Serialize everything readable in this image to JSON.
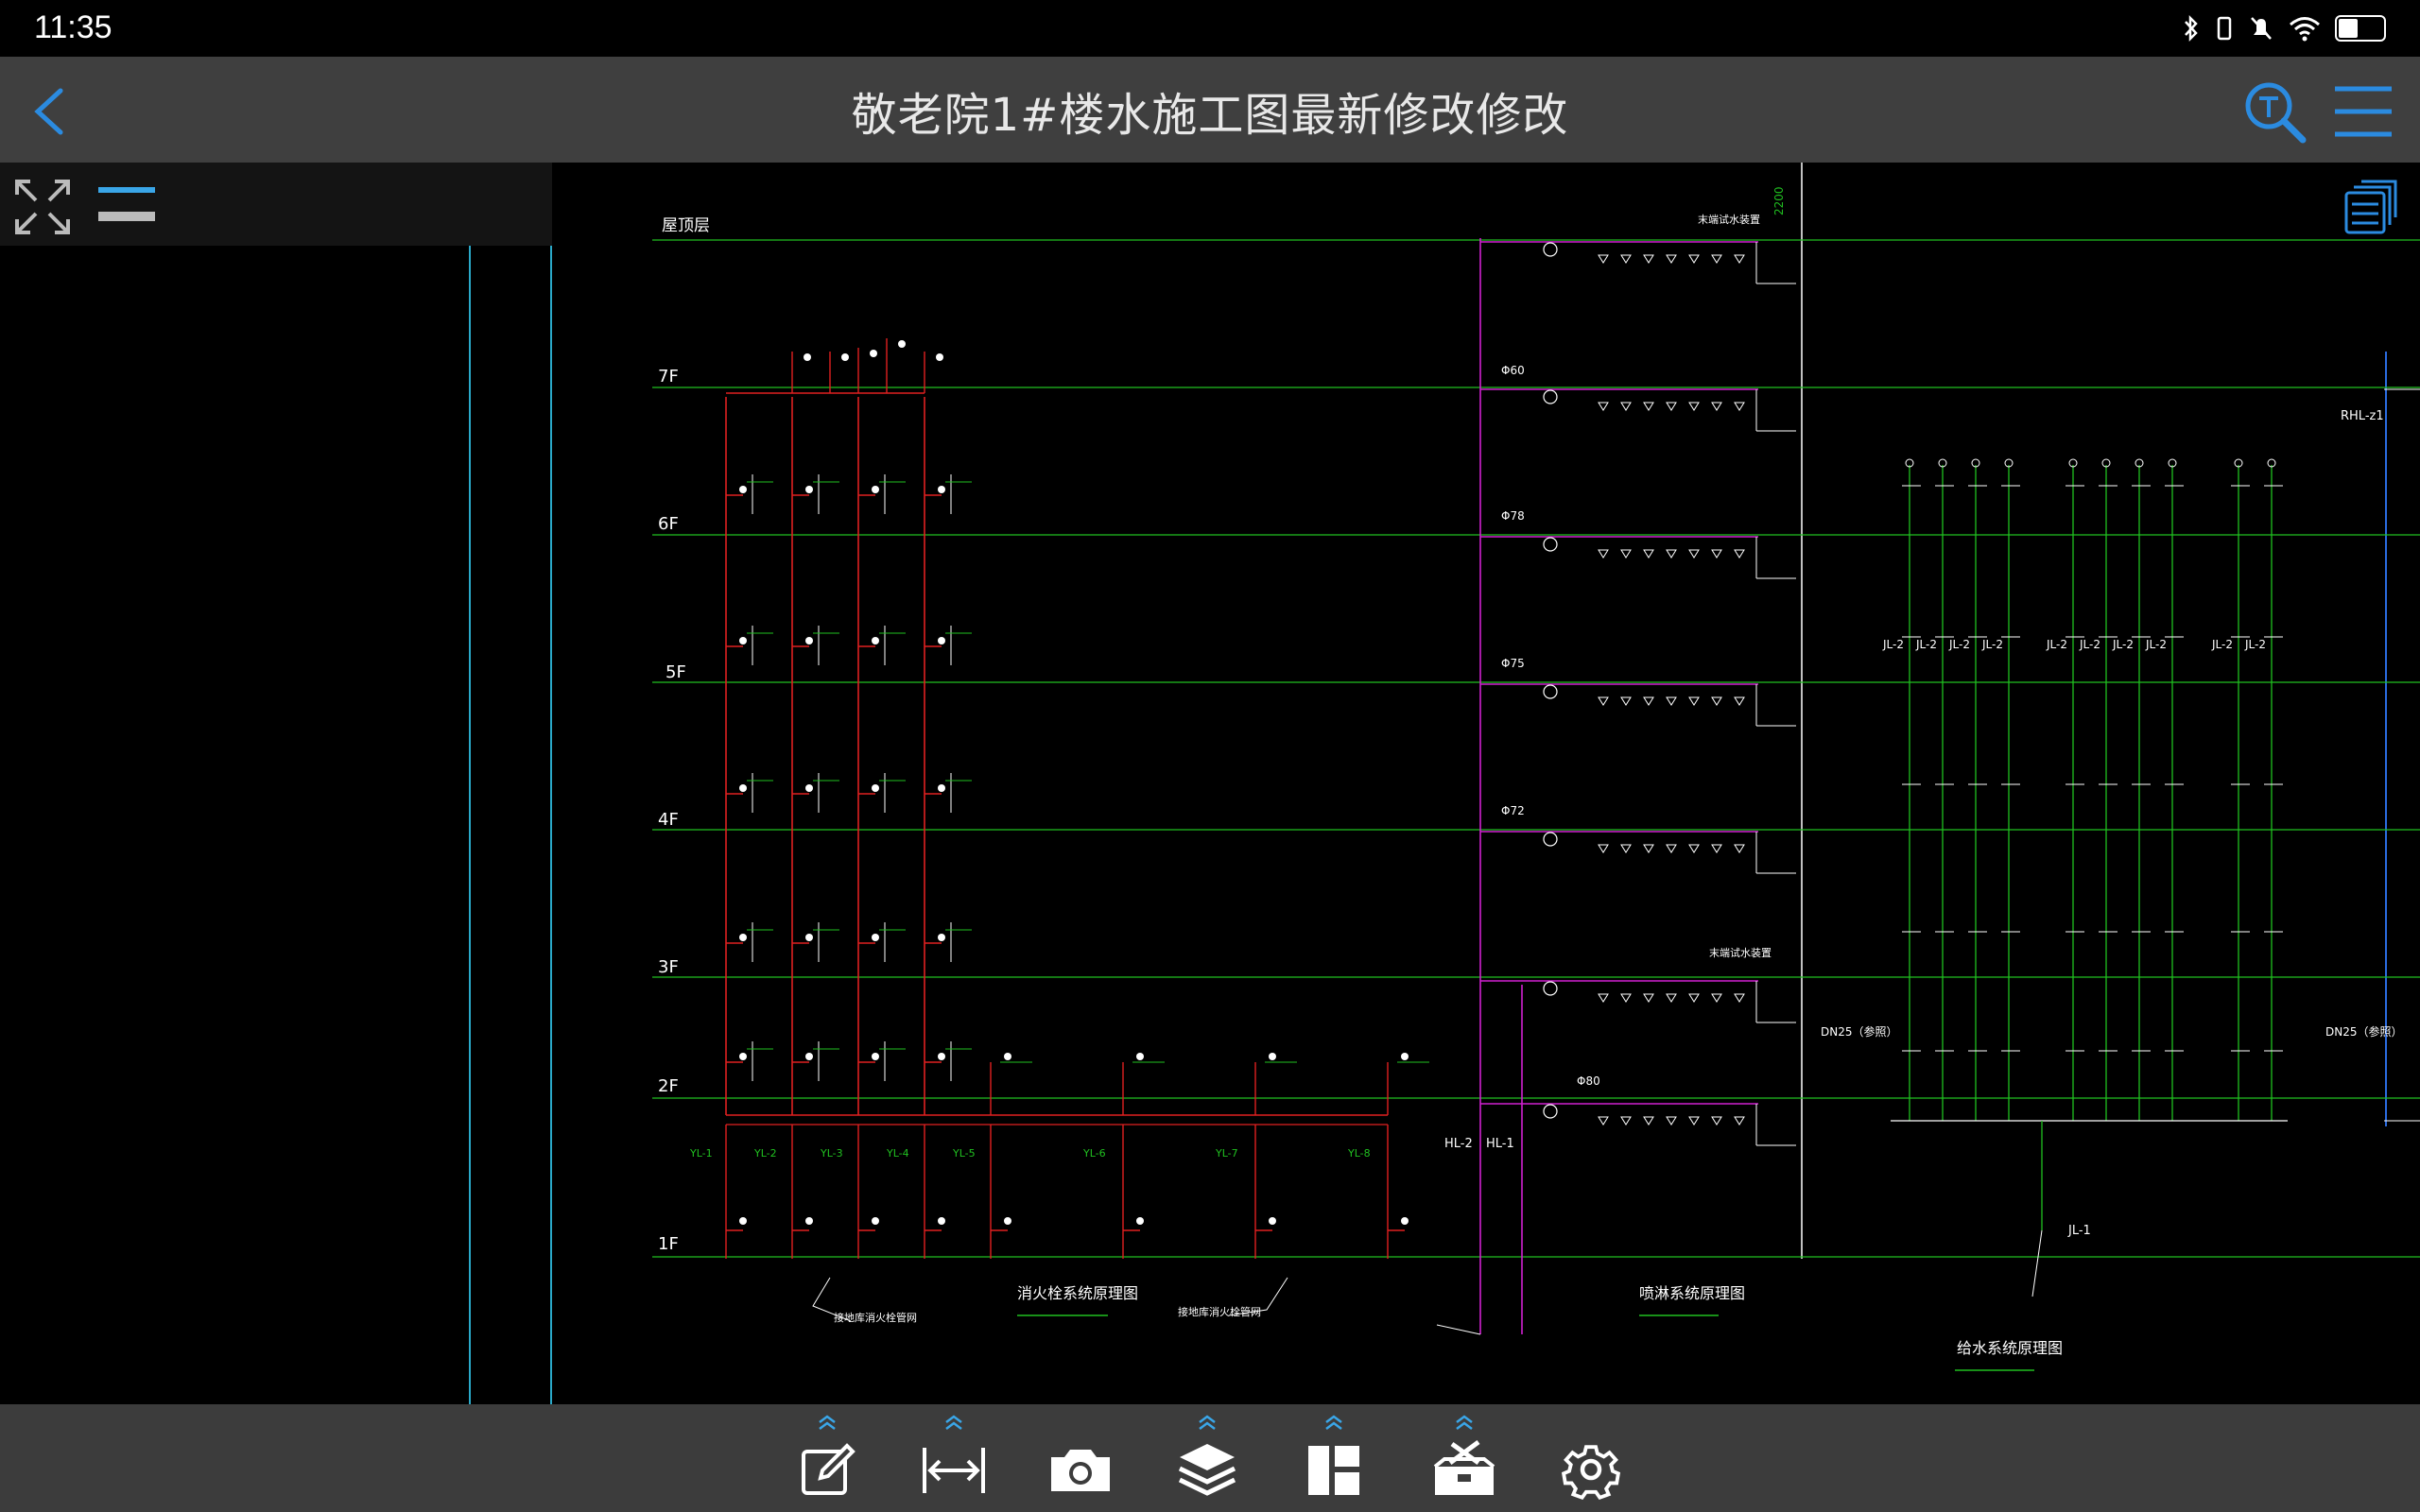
{
  "status": {
    "time": "11:35",
    "battery": "40"
  },
  "header": {
    "title": "敬老院1#楼水施工图最新修改修改"
  },
  "drawing": {
    "floors": [
      "屋顶层",
      "7F",
      "6F",
      "5F",
      "4F",
      "3F",
      "2F",
      "1F"
    ],
    "captions": {
      "fire_hydrant": "消火栓系统原理图",
      "sprinkler": "喷淋系统原理图",
      "water_supply": "给水系统原理图",
      "hydrant_pipe": "接地库消火栓管网",
      "hydrant_pipe2": "接地库消火栓管网"
    },
    "riser_labels": [
      "YL-1",
      "YL-2",
      "YL-3",
      "YL-4",
      "YL-5",
      "YL-6",
      "YL-7",
      "YL-8"
    ],
    "sprinkler_risers": [
      "HL-2",
      "HL-1"
    ],
    "supply_riser": "JL-1",
    "supply_branch": "JL-2",
    "rhl": "RHL-z1",
    "dn25": "DN25（参照）",
    "reducer_labels": [
      "Φ60",
      "Φ78",
      "Φ75",
      "Φ72",
      "Φ80"
    ],
    "dim": "2200",
    "end_test": "末端试水装置"
  },
  "colors": {
    "background": "#000000",
    "titlebar": "#3f3f3f",
    "toolbar": "#3c3c3c",
    "accent": "#2b8be0",
    "pipe_red": "#e02020",
    "pipe_magenta": "#d020d0",
    "pipe_green": "#20c020",
    "line_white": "#ffffff"
  },
  "toolbar": {
    "items": [
      "edit-icon",
      "measure-icon",
      "camera-icon",
      "layers-icon",
      "layout-icon",
      "toolbox-icon",
      "settings-icon"
    ]
  }
}
